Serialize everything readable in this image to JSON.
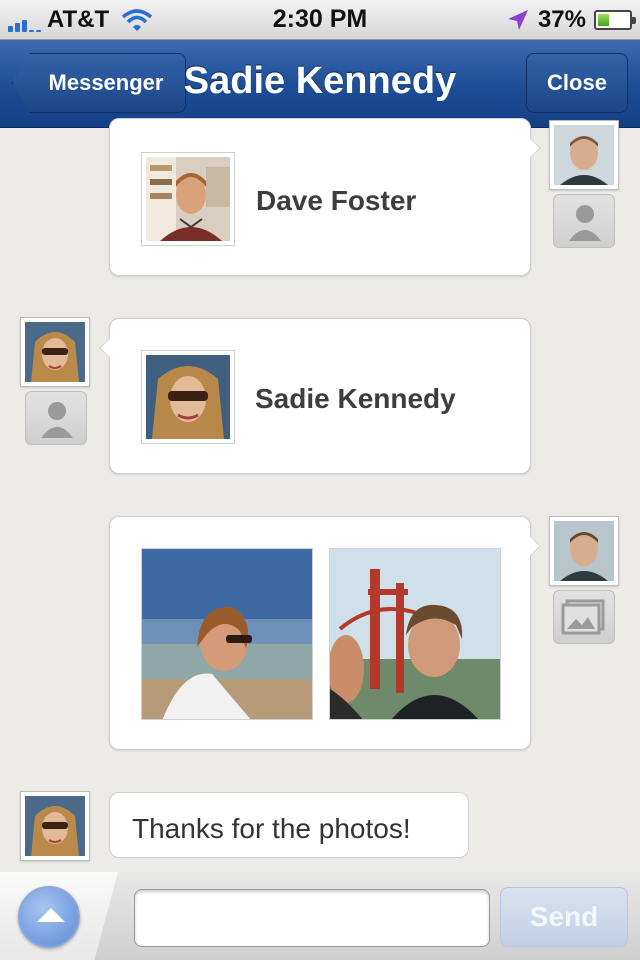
{
  "status_bar": {
    "carrier": "AT&T",
    "time": "2:30 PM",
    "battery_percent": "37%",
    "battery_level": 0.37,
    "icons": [
      "signal-icon",
      "wifi-icon",
      "location-arrow-icon",
      "battery-icon"
    ]
  },
  "nav": {
    "back_label": "Messenger",
    "title": "Sadie Kennedy",
    "close_label": "Close"
  },
  "messages": [
    {
      "type": "contact",
      "sender": "me",
      "contact_name": "Dave Foster",
      "type_icon": "person-icon"
    },
    {
      "type": "contact",
      "sender": "other",
      "contact_name": "Sadie Kennedy",
      "type_icon": "person-icon"
    },
    {
      "type": "photos",
      "sender": "me",
      "photo_count": 2,
      "type_icon": "photo-icon"
    },
    {
      "type": "text",
      "sender": "other",
      "text": "Thanks for the photos!"
    }
  ],
  "compose": {
    "input_placeholder": "",
    "send_label": "Send"
  },
  "colors": {
    "nav_blue": "#1e4f98",
    "background": "#ecebe7",
    "send_disabled": "#c1cfe6"
  }
}
